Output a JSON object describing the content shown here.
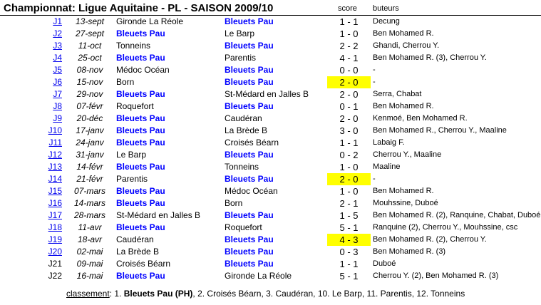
{
  "title": "Championnat: Ligue Aquitaine - PL - SAISON 2009/10",
  "headers": {
    "score": "score",
    "buteurs": "buteurs"
  },
  "team": "Bleuets Pau",
  "highlight_color": "#ffff00",
  "matches": [
    {
      "j": "J1",
      "link": true,
      "date": "13-sept",
      "home": "Gironde La Réole",
      "away": "Bleuets Pau",
      "score": "1 - 1",
      "buteurs": "Decung",
      "hl": false
    },
    {
      "j": "J2",
      "link": true,
      "date": "27-sept",
      "home": "Bleuets Pau",
      "away": "Le Barp",
      "score": "1 - 0",
      "buteurs": "Ben Mohamed R.",
      "hl": false
    },
    {
      "j": "J3",
      "link": true,
      "date": "11-oct",
      "home": "Tonneins",
      "away": "Bleuets Pau",
      "score": "2 - 2",
      "buteurs": "Ghandi, Cherrou Y.",
      "hl": false
    },
    {
      "j": "J4",
      "link": true,
      "date": "25-oct",
      "home": "Bleuets Pau",
      "away": "Parentis",
      "score": "4 - 1",
      "buteurs": "Ben Mohamed R. (3), Cherrou Y.",
      "hl": false
    },
    {
      "j": "J5",
      "link": true,
      "date": "08-nov",
      "home": "Médoc Océan",
      "away": "Bleuets Pau",
      "score": "0 - 0",
      "buteurs": "-",
      "hl": false
    },
    {
      "j": "J6",
      "link": true,
      "date": "15-nov",
      "home": "Born",
      "away": "Bleuets Pau",
      "score": "2 - 0",
      "buteurs": "-",
      "hl": true
    },
    {
      "j": "J7",
      "link": true,
      "date": "29-nov",
      "home": "Bleuets Pau",
      "away": "St-Médard en Jalles B",
      "score": "2 - 0",
      "buteurs": "Serra, Chabat",
      "hl": false
    },
    {
      "j": "J8",
      "link": true,
      "date": "07-févr",
      "home": "Roquefort",
      "away": "Bleuets Pau",
      "score": "0 - 1",
      "buteurs": "Ben Mohamed R.",
      "hl": false
    },
    {
      "j": "J9",
      "link": true,
      "date": "20-déc",
      "home": "Bleuets Pau",
      "away": "Caudéran",
      "score": "2 - 0",
      "buteurs": "Kenmoé, Ben Mohamed R.",
      "hl": false
    },
    {
      "j": "J10",
      "link": true,
      "date": "17-janv",
      "home": "Bleuets Pau",
      "away": "La Brède B",
      "score": "3 - 0",
      "buteurs": "Ben Mohamed R., Cherrou Y., Maaline",
      "hl": false
    },
    {
      "j": "J11",
      "link": true,
      "date": "24-janv",
      "home": "Bleuets Pau",
      "away": "Croisés Béarn",
      "score": "1 - 1",
      "buteurs": "Labaig F.",
      "hl": false
    },
    {
      "j": "J12",
      "link": true,
      "date": "31-janv",
      "home": "Le Barp",
      "away": "Bleuets Pau",
      "score": "0 - 2",
      "buteurs": "Cherrou Y., Maaline",
      "hl": false
    },
    {
      "j": "J13",
      "link": true,
      "date": "14-févr",
      "home": "Bleuets Pau",
      "away": "Tonneins",
      "score": "1 - 0",
      "buteurs": "Maaline",
      "hl": false
    },
    {
      "j": "J14",
      "link": true,
      "date": "21-févr",
      "home": "Parentis",
      "away": "Bleuets Pau",
      "score": "2 - 0",
      "buteurs": "-",
      "hl": true
    },
    {
      "j": "J15",
      "link": true,
      "date": "07-mars",
      "home": "Bleuets Pau",
      "away": "Médoc Océan",
      "score": "1 - 0",
      "buteurs": "Ben Mohamed R.",
      "hl": false
    },
    {
      "j": "J16",
      "link": true,
      "date": "14-mars",
      "home": "Bleuets Pau",
      "away": "Born",
      "score": "2 - 1",
      "buteurs": "Mouhssine, Duboé",
      "hl": false
    },
    {
      "j": "J17",
      "link": true,
      "date": "28-mars",
      "home": "St-Médard en Jalles B",
      "away": "Bleuets Pau",
      "score": "1 - 5",
      "buteurs": "Ben Mohamed R. (2), Ranquine, Chabat, Duboé",
      "hl": false
    },
    {
      "j": "J18",
      "link": true,
      "date": "11-avr",
      "home": "Bleuets Pau",
      "away": "Roquefort",
      "score": "5 - 1",
      "buteurs": "Ranquine (2), Cherrou Y., Mouhssine, csc",
      "hl": false
    },
    {
      "j": "J19",
      "link": true,
      "date": "18-avr",
      "home": "Caudéran",
      "away": "Bleuets Pau",
      "score": "4 - 3",
      "buteurs": "Ben Mohamed R. (2), Cherrou Y.",
      "hl": true
    },
    {
      "j": "J20",
      "link": true,
      "date": "02-mai",
      "home": "La Brède B",
      "away": "Bleuets Pau",
      "score": "0 - 3",
      "buteurs": "Ben Mohamed R. (3)",
      "hl": false
    },
    {
      "j": "J21",
      "link": false,
      "date": "09-mai",
      "home": "Croisés Béarn",
      "away": "Bleuets Pau",
      "score": "1 - 1",
      "buteurs": "Duboé",
      "hl": false
    },
    {
      "j": "J22",
      "link": false,
      "date": "16-mai",
      "home": "Bleuets Pau",
      "away": "Gironde La Réole",
      "score": "5 - 1",
      "buteurs": "Cherrou Y. (2), Ben Mohamed R. (3)",
      "hl": false
    }
  ],
  "classement": {
    "label": "classement",
    "sep": ": 1. ",
    "first": "Bleuets Pau (PH)",
    "rest": ", 2. Croisés Béarn, 3. Caudéran, 10. Le Barp, 11. Parentis, 12. Tonneins"
  }
}
